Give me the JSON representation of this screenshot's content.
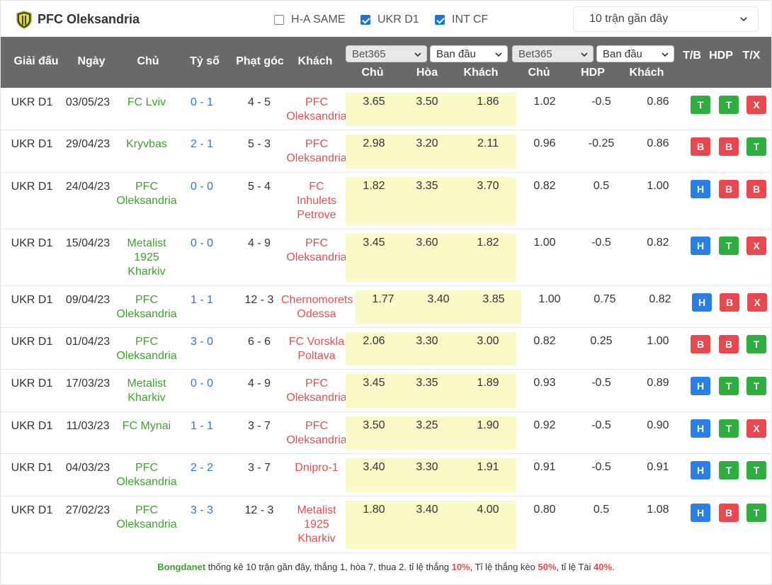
{
  "header": {
    "team": "PFC Oleksandria",
    "filters": [
      {
        "label": "H-A SAME",
        "checked": false
      },
      {
        "label": "UKR D1",
        "checked": true
      },
      {
        "label": "INT CF",
        "checked": true
      }
    ],
    "range": "10 trận gần đây"
  },
  "columns": {
    "league": "Giải đấu",
    "date": "Ngày",
    "home": "Chủ",
    "score": "Tỷ số",
    "corner": "Phạt góc",
    "away": "Khách",
    "bookmaker1": "Bet365",
    "type1": "Ban đầu",
    "bookmaker2": "Bet365",
    "type2": "Ban đầu",
    "eu_home": "Chủ",
    "eu_draw": "Hòa",
    "eu_away": "Khách",
    "ah_home": "Chủ",
    "ah_hdp": "HDP",
    "ah_away": "Khách",
    "tb": "T/B",
    "hdp": "HDP",
    "tx": "T/X"
  },
  "rows": [
    {
      "league": "UKR D1",
      "date": "03/05/23",
      "home": [
        "FC Lviv"
      ],
      "home_color": "green",
      "score": "0 - 1",
      "corner": "4 - 5",
      "away": [
        "PFC",
        "Oleksandria"
      ],
      "away_color": "red",
      "eu": [
        "3.65",
        "3.50",
        "1.86"
      ],
      "ah": [
        "1.02",
        "-0.5",
        "0.86"
      ],
      "res": [
        "T",
        "T",
        "X"
      ]
    },
    {
      "league": "UKR D1",
      "date": "29/04/23",
      "home": [
        "Kryvbas"
      ],
      "home_color": "green",
      "score": "2 - 1",
      "corner": "5 - 3",
      "away": [
        "PFC",
        "Oleksandria"
      ],
      "away_color": "red",
      "eu": [
        "2.98",
        "3.20",
        "2.11"
      ],
      "ah": [
        "0.96",
        "-0.25",
        "0.86"
      ],
      "res": [
        "B",
        "B",
        "T"
      ]
    },
    {
      "league": "UKR D1",
      "date": "24/04/23",
      "home": [
        "PFC",
        "Oleksandria"
      ],
      "home_color": "green",
      "score": "0 - 0",
      "corner": "5 - 4",
      "away": [
        "FC",
        "Inhulets",
        "Petrove"
      ],
      "away_color": "red",
      "eu": [
        "1.82",
        "3.35",
        "3.70"
      ],
      "ah": [
        "0.82",
        "0.5",
        "1.00"
      ],
      "res": [
        "H",
        "B",
        "B"
      ]
    },
    {
      "league": "UKR D1",
      "date": "15/04/23",
      "home": [
        "Metalist",
        "1925",
        "Kharkiv"
      ],
      "home_color": "green",
      "score": "0 - 0",
      "corner": "4 - 9",
      "away": [
        "PFC",
        "Oleksandria"
      ],
      "away_color": "red",
      "eu": [
        "3.45",
        "3.60",
        "1.82"
      ],
      "ah": [
        "1.00",
        "-0.5",
        "0.82"
      ],
      "res": [
        "H",
        "T",
        "X"
      ]
    },
    {
      "league": "UKR D1",
      "date": "09/04/23",
      "home": [
        "PFC",
        "Oleksandria"
      ],
      "home_color": "green",
      "score": "1 - 1",
      "corner": "12 - 3",
      "away": [
        "Chernomorets",
        "Odessa"
      ],
      "away_color": "red",
      "eu": [
        "1.77",
        "3.40",
        "3.85"
      ],
      "ah": [
        "1.00",
        "0.75",
        "0.82"
      ],
      "res": [
        "H",
        "B",
        "X"
      ]
    },
    {
      "league": "UKR D1",
      "date": "01/04/23",
      "home": [
        "PFC",
        "Oleksandria"
      ],
      "home_color": "green",
      "score": "3 - 0",
      "corner": "6 - 6",
      "away": [
        "FC Vorskla",
        "Poltava"
      ],
      "away_color": "red",
      "eu": [
        "2.06",
        "3.30",
        "3.00"
      ],
      "ah": [
        "0.82",
        "0.25",
        "1.00"
      ],
      "res": [
        "B",
        "B",
        "T"
      ]
    },
    {
      "league": "UKR D1",
      "date": "17/03/23",
      "home": [
        "Metalist",
        "Kharkiv"
      ],
      "home_color": "green",
      "score": "0 - 0",
      "corner": "4 - 9",
      "away": [
        "PFC",
        "Oleksandria"
      ],
      "away_color": "red",
      "eu": [
        "3.45",
        "3.35",
        "1.89"
      ],
      "ah": [
        "0.93",
        "-0.5",
        "0.89"
      ],
      "res": [
        "H",
        "T",
        "T"
      ]
    },
    {
      "league": "UKR D1",
      "date": "11/03/23",
      "home": [
        "FC Mynai"
      ],
      "home_color": "green",
      "score": "1 - 1",
      "corner": "3 - 7",
      "away": [
        "PFC",
        "Oleksandria"
      ],
      "away_color": "red",
      "eu": [
        "3.50",
        "3.25",
        "1.90"
      ],
      "ah": [
        "0.92",
        "-0.5",
        "0.90"
      ],
      "res": [
        "H",
        "T",
        "X"
      ]
    },
    {
      "league": "UKR D1",
      "date": "04/03/23",
      "home": [
        "PFC",
        "Oleksandria"
      ],
      "home_color": "green",
      "score": "2 - 2",
      "corner": "3 - 7",
      "away": [
        "Dnipro-1"
      ],
      "away_color": "red",
      "eu": [
        "3.40",
        "3.30",
        "1.91"
      ],
      "ah": [
        "0.91",
        "-0.5",
        "0.91"
      ],
      "res": [
        "H",
        "T",
        "T"
      ]
    },
    {
      "league": "UKR D1",
      "date": "27/02/23",
      "home": [
        "PFC",
        "Oleksandria"
      ],
      "home_color": "green",
      "score": "3 - 3",
      "corner": "12 - 3",
      "away": [
        "Metalist",
        "1925",
        "Kharkiv"
      ],
      "away_color": "red",
      "eu": [
        "1.80",
        "3.40",
        "4.00"
      ],
      "ah": [
        "0.80",
        "0.5",
        "1.08"
      ],
      "res": [
        "H",
        "B",
        "T"
      ]
    }
  ],
  "footer": {
    "brand": "Bongdanet",
    "text1": " thống kê 10 trận gần đây, thắng 1, hòa 7, thua 2. tỉ lệ thắng ",
    "win_pct": "10%",
    "text2": ", Tỉ lệ thắng kèo ",
    "ah_pct": "50%",
    "text3": ", tỉ lệ Tài ",
    "over_pct": "40%",
    "text4": "."
  },
  "colors": {
    "header_bg": "#696969",
    "odds_bg": "#fbf9c8",
    "win": "#2eae3e",
    "loss": "#e9474e",
    "draw": "#2a7fe5",
    "home_text": "#3aa52a",
    "away_text": "#e05050",
    "score_text": "#2a78d4"
  }
}
